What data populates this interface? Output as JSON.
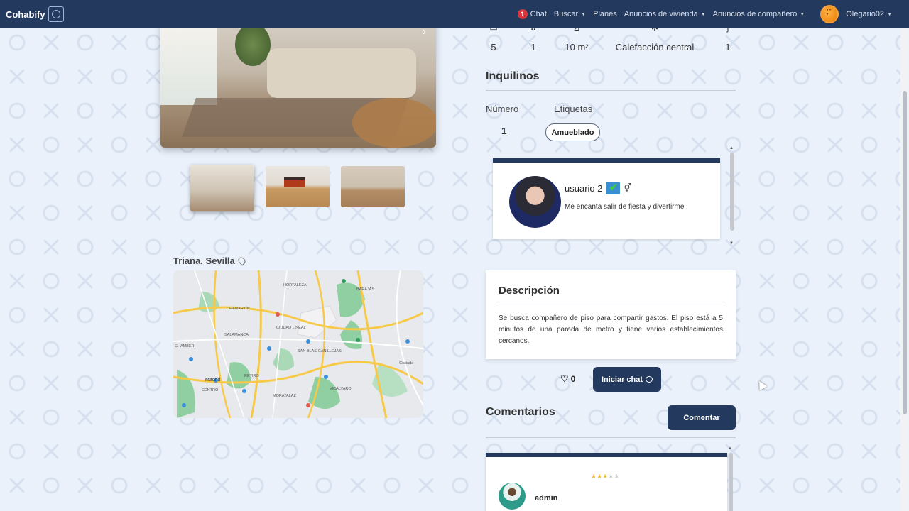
{
  "nav": {
    "brand": "Cohabify",
    "chat_badge": "1",
    "chat": "Chat",
    "buscar": "Buscar",
    "planes": "Planes",
    "anuncios_vivienda": "Anuncios de vivienda",
    "anuncios_companero": "Anuncios de compañero",
    "user": "Olegario02"
  },
  "features": [
    {
      "icon": "bed-icon",
      "value": "5"
    },
    {
      "icon": "shower-icon",
      "value": "1"
    },
    {
      "icon": "area-icon",
      "value": "10 m²"
    },
    {
      "icon": "heating-icon",
      "value": "Calefacción central"
    },
    {
      "icon": "tap-icon",
      "value": "1"
    }
  ],
  "tenants": {
    "title": "Inquilinos",
    "number_label": "Número",
    "tags_label": "Etiquetas",
    "number": "1",
    "tag": "Amueblado",
    "card": {
      "name": "usuario 2",
      "gender_symbol": "⚥",
      "bio": "Me encanta salir de fiesta y divertirme"
    }
  },
  "location": "Triana, Sevilla",
  "map": {
    "labels": [
      "HORTALEZA",
      "CHAMARTÍN",
      "BARAJAS",
      "CIUDAD LINEAL",
      "SAN BLAS-CANILLEJAS",
      "CHAMBERÍ",
      "SALAMANCA",
      "Madrid",
      "CENTRO",
      "RETIRO",
      "MORATALAZ",
      "VICÁLVARO",
      "Coslada"
    ]
  },
  "description": {
    "title": "Descripción",
    "text": "Se busca compañero de piso para compartir gastos. El piso está a 5 minutos de una parada de metro y tiene varios establecimientos cercanos."
  },
  "likes": "0",
  "chat_button": "Iniciar chat",
  "comments": {
    "title": "Comentarios",
    "button": "Comentar",
    "items": [
      {
        "user": "admin",
        "rating": 3,
        "max": 5
      }
    ]
  },
  "colors": {
    "primary": "#23395d",
    "background": "#eaf1fb"
  }
}
